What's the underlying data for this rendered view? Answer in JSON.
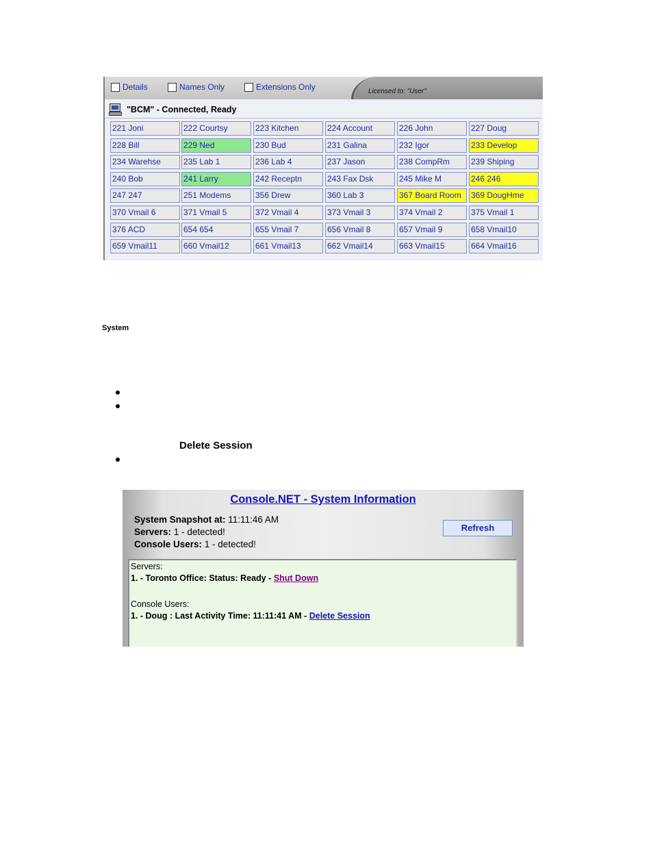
{
  "toolbar": {
    "details_label": "Details",
    "names_only_label": "Names Only",
    "extensions_only_label": "Extensions Only",
    "licensed_to": "Licensed to: \"User\""
  },
  "connection_status": "\"BCM\" - Connected, Ready",
  "extensions": [
    {
      "label": "221 Joni",
      "state": "idle"
    },
    {
      "label": "222 Courtsy",
      "state": "idle"
    },
    {
      "label": "223 Kitchen",
      "state": "idle"
    },
    {
      "label": "224 Account",
      "state": "idle"
    },
    {
      "label": "226 John",
      "state": "idle"
    },
    {
      "label": "227 Doug",
      "state": "idle"
    },
    {
      "label": "228 Bill",
      "state": "idle"
    },
    {
      "label": "229 Ned",
      "state": "green"
    },
    {
      "label": "230 Bud",
      "state": "idle"
    },
    {
      "label": "231 Galina",
      "state": "idle"
    },
    {
      "label": "232 Igor",
      "state": "idle"
    },
    {
      "label": "233 Develop",
      "state": "yellow"
    },
    {
      "label": "234 Warehse",
      "state": "idle"
    },
    {
      "label": "235 Lab 1",
      "state": "idle"
    },
    {
      "label": "236 Lab 4",
      "state": "idle"
    },
    {
      "label": "237 Jason",
      "state": "idle"
    },
    {
      "label": "238 CompRm",
      "state": "idle"
    },
    {
      "label": "239 Shiping",
      "state": "idle"
    },
    {
      "label": "240 Bob",
      "state": "idle"
    },
    {
      "label": "241 Larry",
      "state": "green"
    },
    {
      "label": "242 Receptn",
      "state": "idle"
    },
    {
      "label": "243 Fax Dsk",
      "state": "idle"
    },
    {
      "label": "245 Mike M",
      "state": "idle"
    },
    {
      "label": "246 246",
      "state": "yellow"
    },
    {
      "label": "247 247",
      "state": "idle"
    },
    {
      "label": "251 Modems",
      "state": "idle"
    },
    {
      "label": "356 Drew",
      "state": "idle"
    },
    {
      "label": "360 Lab 3",
      "state": "idle"
    },
    {
      "label": "367 Board Room",
      "state": "yellow"
    },
    {
      "label": "369 DougHme",
      "state": "yellow"
    },
    {
      "label": "370 Vmail 6",
      "state": "idle"
    },
    {
      "label": "371 Vmail 5",
      "state": "idle"
    },
    {
      "label": "372 Vmail 4",
      "state": "idle"
    },
    {
      "label": "373 Vmail 3",
      "state": "idle"
    },
    {
      "label": "374 Vmail 2",
      "state": "idle"
    },
    {
      "label": "375 Vmail 1",
      "state": "idle"
    },
    {
      "label": "376 ACD",
      "state": "idle"
    },
    {
      "label": "654 654",
      "state": "idle"
    },
    {
      "label": "655 Vmail 7",
      "state": "idle"
    },
    {
      "label": "656 Vmail 8",
      "state": "idle"
    },
    {
      "label": "657 Vmail 9",
      "state": "idle"
    },
    {
      "label": "658 Vmail10",
      "state": "idle"
    },
    {
      "label": "659 Vmail11",
      "state": "idle"
    },
    {
      "label": "660 Vmail12",
      "state": "idle"
    },
    {
      "label": "661 Vmail13",
      "state": "idle"
    },
    {
      "label": "662 Vmail14",
      "state": "idle"
    },
    {
      "label": "663 Vmail15",
      "state": "idle"
    },
    {
      "label": "664 Vmail16",
      "state": "idle"
    }
  ],
  "colors": {
    "green": "#8fe88f",
    "yellow": "#ffff20",
    "idle": "#e9e9ea",
    "link_blue": "#1414c8",
    "link_visited": "#800080"
  },
  "doc": {
    "system_label": "System",
    "delete_session_label": "Delete Session"
  },
  "sysinfo": {
    "title": "Console.NET - System Information",
    "snapshot_label": "System Snapshot at:",
    "snapshot_value": "11:11:46 AM",
    "servers_label": "Servers:",
    "servers_value": "1 - detected!",
    "users_label": "Console Users:",
    "users_value": "1 - detected!",
    "refresh_label": "Refresh",
    "box": {
      "servers_heading": "Servers:",
      "server_entry": "1. - Toronto Office: Status: Ready - ",
      "shutdown_link": "Shut Down",
      "users_heading": "Console Users:",
      "user_entry": "1. - Doug : Last Activity Time: 11:11:41 AM - ",
      "delete_link": "Delete Session"
    }
  }
}
